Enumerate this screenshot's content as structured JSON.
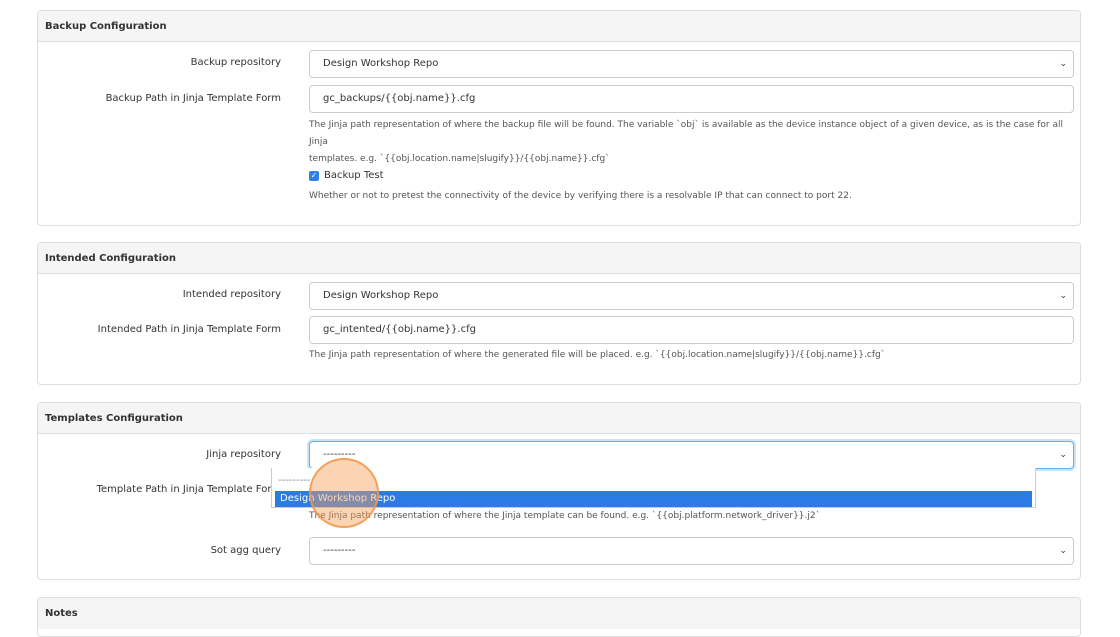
{
  "backup": {
    "heading": "Backup Configuration",
    "repo_label": "Backup repository",
    "repo_value": "Design Workshop Repo",
    "path_label": "Backup Path in Jinja Template Form",
    "path_value": "gc_backups/{{obj.name}}.cfg",
    "path_help_line1": "The Jinja path representation of where the backup file will be found. The variable `obj` is available as the device instance object of a given device, as is the case for all Jinja",
    "path_help_line2": "templates. e.g. `{{obj.location.name|slugify}}/{{obj.name}}.cfg`",
    "test_label": "Backup Test",
    "test_checked": true,
    "test_help": "Whether or not to pretest the connectivity of the device by verifying there is a resolvable IP that can connect to port 22."
  },
  "intended": {
    "heading": "Intended Configuration",
    "repo_label": "Intended repository",
    "repo_value": "Design Workshop Repo",
    "path_label": "Intended Path in Jinja Template Form",
    "path_value": "gc_intented/{{obj.name}}.cfg",
    "path_help": "The Jinja path representation of where the generated file will be placed. e.g. `{{obj.location.name|slugify}}/{{obj.name}}.cfg`"
  },
  "templates": {
    "heading": "Templates Configuration",
    "repo_label": "Jinja repository",
    "repo_value": "---------",
    "dropdown_options": [
      "---------",
      "Design Workshop Repo"
    ],
    "dropdown_highlighted": "Design Workshop Repo",
    "path_label": "Template Path in Jinja Template Form",
    "path_help": "The Jinja path representation of where the Jinja template can be found. e.g. `{{obj.platform.network_driver}}.j2`",
    "sot_label": "Sot agg query",
    "sot_value": "---------"
  },
  "notes": {
    "heading": "Notes"
  },
  "icons": {
    "select_chevron": "chevron-down-icon",
    "checkbox_check": "check-icon"
  },
  "colors": {
    "focus_border": "#66afe9",
    "option_highlight": "#2c7be5",
    "cursor_ring": "#f5a05a"
  }
}
